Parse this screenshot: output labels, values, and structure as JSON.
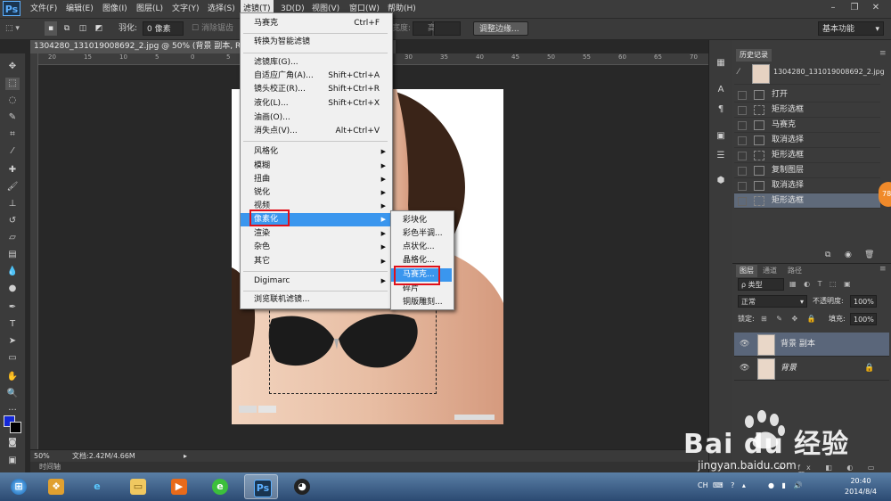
{
  "app": {
    "logo": "Ps"
  },
  "menubar": {
    "items": [
      "文件(F)",
      "编辑(E)",
      "图像(I)",
      "图层(L)",
      "文字(Y)",
      "选择(S)",
      "滤镜(T)",
      "3D(D)",
      "视图(V)",
      "窗口(W)",
      "帮助(H)"
    ],
    "active_index": 6
  },
  "options": {
    "feather_label": "羽化:",
    "feather_value": "0 像素",
    "antialias_label": "消除锯齿",
    "style_label": "样式:",
    "width_label": "宽度:",
    "height_label": "高度:",
    "refine_edge": "调整边缘...",
    "workspace": "基本功能"
  },
  "document": {
    "tab_title": "1304280_131019008692_2.jpg @ 50% (背景 副本, RGB/8#)",
    "zoom": "50%",
    "doc_info": "文档:2.42M/4.66M",
    "timeline_label": "时间轴",
    "ruler_numbers": [
      "20",
      "15",
      "10",
      "5",
      "0",
      "5",
      "10",
      "15",
      "20",
      "25",
      "30",
      "35",
      "40",
      "45",
      "50",
      "55",
      "60",
      "65",
      "70",
      "75"
    ]
  },
  "filter_menu": {
    "items": [
      {
        "label": "马赛克",
        "shortcut": "Ctrl+F"
      },
      {
        "label": "转换为智能滤镜",
        "shortcut": ""
      },
      {
        "label": "滤镜库(G)...",
        "shortcut": ""
      },
      {
        "label": "自适应广角(A)...",
        "shortcut": "Shift+Ctrl+A"
      },
      {
        "label": "镜头校正(R)...",
        "shortcut": "Shift+Ctrl+R"
      },
      {
        "label": "液化(L)...",
        "shortcut": "Shift+Ctrl+X"
      },
      {
        "label": "油画(O)...",
        "shortcut": ""
      },
      {
        "label": "消失点(V)...",
        "shortcut": "Alt+Ctrl+V"
      },
      {
        "label": "风格化",
        "shortcut": ""
      },
      {
        "label": "模糊",
        "shortcut": ""
      },
      {
        "label": "扭曲",
        "shortcut": ""
      },
      {
        "label": "锐化",
        "shortcut": ""
      },
      {
        "label": "视频",
        "shortcut": ""
      },
      {
        "label": "像素化",
        "shortcut": ""
      },
      {
        "label": "渲染",
        "shortcut": ""
      },
      {
        "label": "杂色",
        "shortcut": ""
      },
      {
        "label": "其它",
        "shortcut": ""
      },
      {
        "label": "Digimarc",
        "shortcut": ""
      },
      {
        "label": "浏览联机滤镜...",
        "shortcut": ""
      }
    ]
  },
  "pixelate_submenu": {
    "items": [
      "彩块化",
      "彩色半调...",
      "点状化...",
      "晶格化...",
      "马赛克...",
      "碎片",
      "铜版雕刻..."
    ]
  },
  "history": {
    "tab": "历史记录",
    "snapshot": "1304280_131019008692_2.jpg",
    "steps": [
      "打开",
      "矩形选框",
      "马赛克",
      "取消选择",
      "矩形选框",
      "复制图层",
      "取消选择",
      "矩形选框"
    ]
  },
  "layers": {
    "tabs": [
      "图层",
      "通道",
      "路径"
    ],
    "filter_kind": "ρ 类型",
    "blend_mode": "正常",
    "opacity_label": "不透明度:",
    "opacity_value": "100%",
    "lock_label": "锁定:",
    "fill_label": "填充:",
    "fill_value": "100%",
    "items": [
      "背景 副本",
      "背景"
    ]
  },
  "taskbar": {
    "time": "20:40",
    "date": "2014/8/4",
    "lang": "CH"
  },
  "watermark": {
    "text": "Bai du 经验",
    "url": "jingyan.baidu.com"
  },
  "badge": "78"
}
